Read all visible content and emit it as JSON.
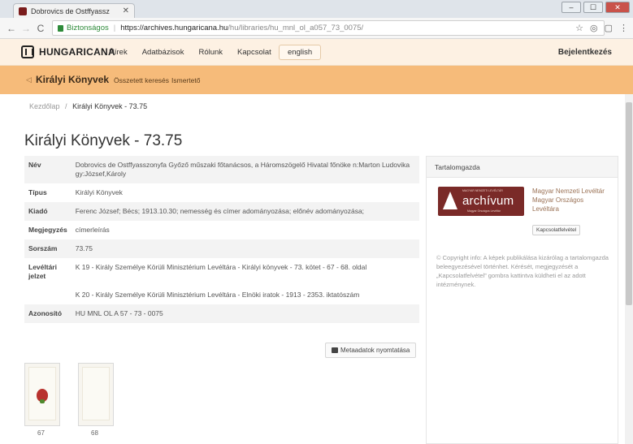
{
  "browser": {
    "tab_title": "Dobrovics de Ostffyassz",
    "tab_close": "✕",
    "win_min": "–",
    "win_max": "☐",
    "win_close": "✕",
    "back": "←",
    "forward": "→",
    "reload": "C",
    "secure_label": "Biztonságos",
    "url_sep": "|",
    "url_host": "https://archives.hungaricana.hu",
    "url_path": "/hu/libraries/hu_mnl_ol_a057_73_0075/",
    "star": "☆",
    "ext1": "◎",
    "ext2": "▢",
    "menu": "⋮"
  },
  "site": {
    "logo_text": "HUNGARICANA",
    "nav": [
      "Hírek",
      "Adatbázisok",
      "Rólunk",
      "Kapcsolat"
    ],
    "lang": "english",
    "login": "Bejelentkezés"
  },
  "subnav": {
    "arrow": "◁",
    "db_name": "Királyi Könyvek",
    "links": [
      "Összetett keresés",
      "Ismertető"
    ]
  },
  "breadcrumb": {
    "home": "Kezdőlap",
    "sep": "/",
    "current": "Királyi Könyvek - 73.75"
  },
  "title": "Királyi Könyvek - 73.75",
  "metadata": [
    {
      "key": "Név",
      "value": "Dobrovics de Ostffyasszonyfa Győző műszaki főtanácsos, a Háromszögelő Hivatal főnöke n:Marton Ludovika gy:József,Károly"
    },
    {
      "key": "Típus",
      "value": "Királyi Könyvek"
    },
    {
      "key": "Kiadó",
      "value": "Ferenc József; Bécs; 1913.10.30; nemesség és címer adományozása; előnév adományozása;"
    },
    {
      "key": "Megjegyzés",
      "value": "címerleírás"
    },
    {
      "key": "Sorszám",
      "value": "73.75"
    },
    {
      "key": "Levéltári jelzet",
      "value": "K 19 - Király Személye Körüli Minisztérium Levéltára - Királyi könyvek - 73. kötet - 67 - 68. oldal"
    },
    {
      "key": "",
      "value": "K 20 - Király Személye Körüli Minisztérium Levéltára - Elnöki iratok - 1913 - 2353. iktatószám"
    },
    {
      "key": "Azonosító",
      "value": "HU MNL OL A 57 - 73 - 0075"
    }
  ],
  "print_button": "Metaadatok nyomtatása",
  "thumbnails": [
    "67",
    "68"
  ],
  "side": {
    "heading": "Tartalomgazda",
    "logo_word": "archívum",
    "logo_top": "MAGYAR NEMZETI LEVÉLTÁR",
    "logo_bottom": "Magyar Országos Levéltár",
    "org": "Magyar Nemzeti Levéltár Magyar Országos Levéltára",
    "contact": "Kapcsolatfelvétel",
    "copyright_symbol": "©",
    "copyright": "Copyright info: A képek publikálása kizárólag a tartalomgazda beleegyezésével történhet. Kérését, megjegyzését a „Kapcsolatfelvétel” gombra kattintva küldheti el az adott intézménynek."
  },
  "colors": {
    "topnav_bg": "#fdf1e3",
    "subnav_bg": "#f6bb7a",
    "archivum_red": "#7a2a28"
  }
}
